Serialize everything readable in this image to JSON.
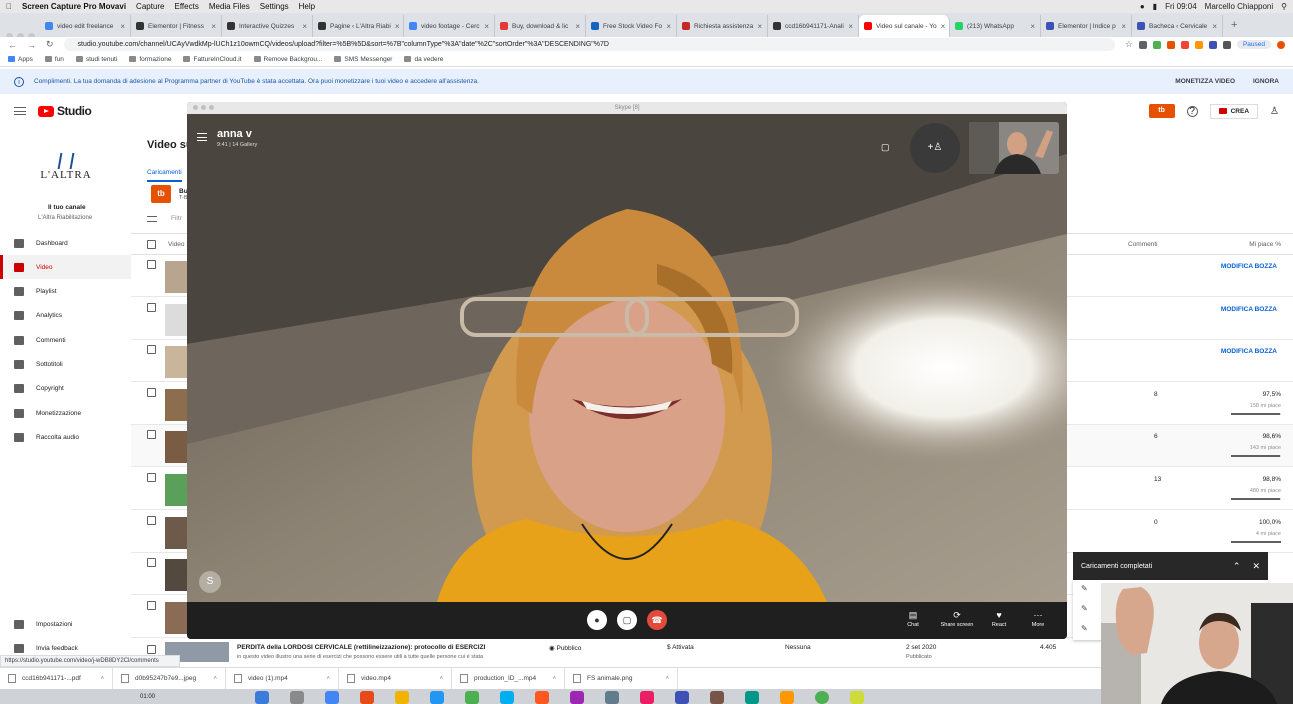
{
  "mac_menu": {
    "app": "Screen Capture Pro Movavi",
    "items": [
      "Capture",
      "Effects",
      "Media Files",
      "Settings",
      "Help"
    ],
    "clock": "Fri 09:04",
    "user": "Marcello Chiapponi"
  },
  "tabs": [
    {
      "label": "video edit freelance",
      "color": "#4285f4"
    },
    {
      "label": "Elementor | Fitness",
      "color": "#333333"
    },
    {
      "label": "Interactive Quizzes",
      "color": "#333333"
    },
    {
      "label": "Pagine ‹ L'Altra Riabi",
      "color": "#333333"
    },
    {
      "label": "video footage - Cerc",
      "color": "#4285f4"
    },
    {
      "label": "Buy, download & lic",
      "color": "#e53935"
    },
    {
      "label": "Free Stock Video Fo",
      "color": "#1565c0"
    },
    {
      "label": "Richiesta assistenza",
      "color": "#c62828"
    },
    {
      "label": "ccd16b941171-Anali",
      "color": "#333333"
    },
    {
      "label": "Video sul canale - Yo",
      "color": "#ff0000",
      "active": true
    },
    {
      "label": "(213) WhatsApp",
      "color": "#25d366"
    },
    {
      "label": "Elementor | Indice p",
      "color": "#3f51b5"
    },
    {
      "label": "Bacheca ‹ Cervicale",
      "color": "#3f51b5"
    }
  ],
  "address": {
    "url": "studio.youtube.com/channel/UCAyVwdkMp-lUCh1z10owmCQ/videos/upload?filter=%5B%5D&sort=%7B\"columnType\"%3A\"date\"%2C\"sortOrder\"%3A\"DESCENDING\"%7D",
    "paused": "Paused"
  },
  "bookmarks": [
    "Apps",
    "fun",
    "studi tenuti",
    "formazione",
    "FattureInCloud.it",
    "Remove Backgrou...",
    "SMS Messenger",
    "da vedere"
  ],
  "banner": {
    "text": "Complimenti. La tua domanda di adesione al Programma partner di YouTube è stata accettata. Ora puoi monetizzare i tuoi video e accedere all'assistenza.",
    "monetize": "MONETIZZA VIDEO",
    "ignore": "IGNORA"
  },
  "studio": {
    "logo_text": "Studio",
    "create_label": "CREA",
    "tb_badge": "tb"
  },
  "channel": {
    "logo_text": "L'ALTRA",
    "your_channel": "Il tuo canale",
    "name": "L'Altra Riabilitazione"
  },
  "sidebar": [
    {
      "label": "Dashboard",
      "icon": "dashboard-icon"
    },
    {
      "label": "Video",
      "icon": "video-icon",
      "active": true
    },
    {
      "label": "Playlist",
      "icon": "playlist-icon"
    },
    {
      "label": "Analytics",
      "icon": "analytics-icon"
    },
    {
      "label": "Commenti",
      "icon": "comments-icon"
    },
    {
      "label": "Sottotitoli",
      "icon": "subtitles-icon"
    },
    {
      "label": "Copyright",
      "icon": "copyright-icon"
    },
    {
      "label": "Monetizzazione",
      "icon": "dollar-icon"
    },
    {
      "label": "Raccolta audio",
      "icon": "audio-library-icon"
    }
  ],
  "sidebar_bottom": [
    {
      "label": "Impostazioni",
      "icon": "gear-icon"
    },
    {
      "label": "Invia feedback",
      "icon": "feedback-icon"
    }
  ],
  "main": {
    "title": "Video su",
    "tab_uploads": "Caricamenti",
    "bulk_label": "Bulk",
    "bulk_sub": "T-Bec",
    "filter_placeholder": "Filtr",
    "col_video": "Video",
    "col_comments": "Commenti",
    "col_likes": "Mi piace %"
  },
  "rows": [
    {
      "edit": "MODIFICA BOZZA"
    },
    {
      "edit": "MODIFICA BOZZA"
    },
    {
      "edit": "MODIFICA BOZZA"
    },
    {
      "comments": "8",
      "likes": "97,5%",
      "likes_sub": "158 mi piace",
      "likes_fraction": 0.975
    },
    {
      "comments": "6",
      "likes": "98,6%",
      "likes_sub": "143 mi piace",
      "likes_fraction": 0.986
    },
    {
      "comments": "13",
      "likes": "98,8%",
      "likes_sub": "480 mi piace",
      "likes_fraction": 0.988
    },
    {
      "comments": "0",
      "likes": "100,0%",
      "likes_sub": "4 mi piace",
      "likes_fraction": 1.0
    },
    {},
    {}
  ],
  "last_row": {
    "title": "PERDITA della LORDOSI CERVICALE (rettilineizzazione): protocollo di ESERCIZI",
    "description": "in questo video illustro una serie di esercizi che possono essere utili a tutte quelle persone cui è stata",
    "visibility": "Pubblico",
    "monetization": "Attivata",
    "restrictions": "Nessuna",
    "date": "2 set 2020",
    "date_sub": "Pubblicato",
    "views": "4.405"
  },
  "skype": {
    "window_title": "Skype [8]",
    "caller_name": "anna v",
    "call_status": "9:41 | 14 Gallery",
    "controls": {
      "chat": "Chat",
      "share": "Share screen",
      "react": "React",
      "more": "More"
    },
    "skype_badge": "S"
  },
  "uploads_panel": {
    "title": "Caricamenti completati"
  },
  "status_url": "https://studio.youtube.com/video/j-wDB8DY2Cl/comments",
  "downloads": [
    {
      "name": "ccd16b941171-...pdf"
    },
    {
      "name": "d0b95247b7e9...jpeg"
    },
    {
      "name": "video (1).mp4"
    },
    {
      "name": "video.mp4"
    },
    {
      "name": "production_ID_...mp4"
    },
    {
      "name": "FS animale.png"
    }
  ],
  "dock": {
    "time": "01:00"
  },
  "colors": {
    "yt_red": "#ff0000",
    "link_blue": "#065fd4",
    "tubebuddy_orange": "#e65100",
    "end_call": "#e24b3b"
  }
}
